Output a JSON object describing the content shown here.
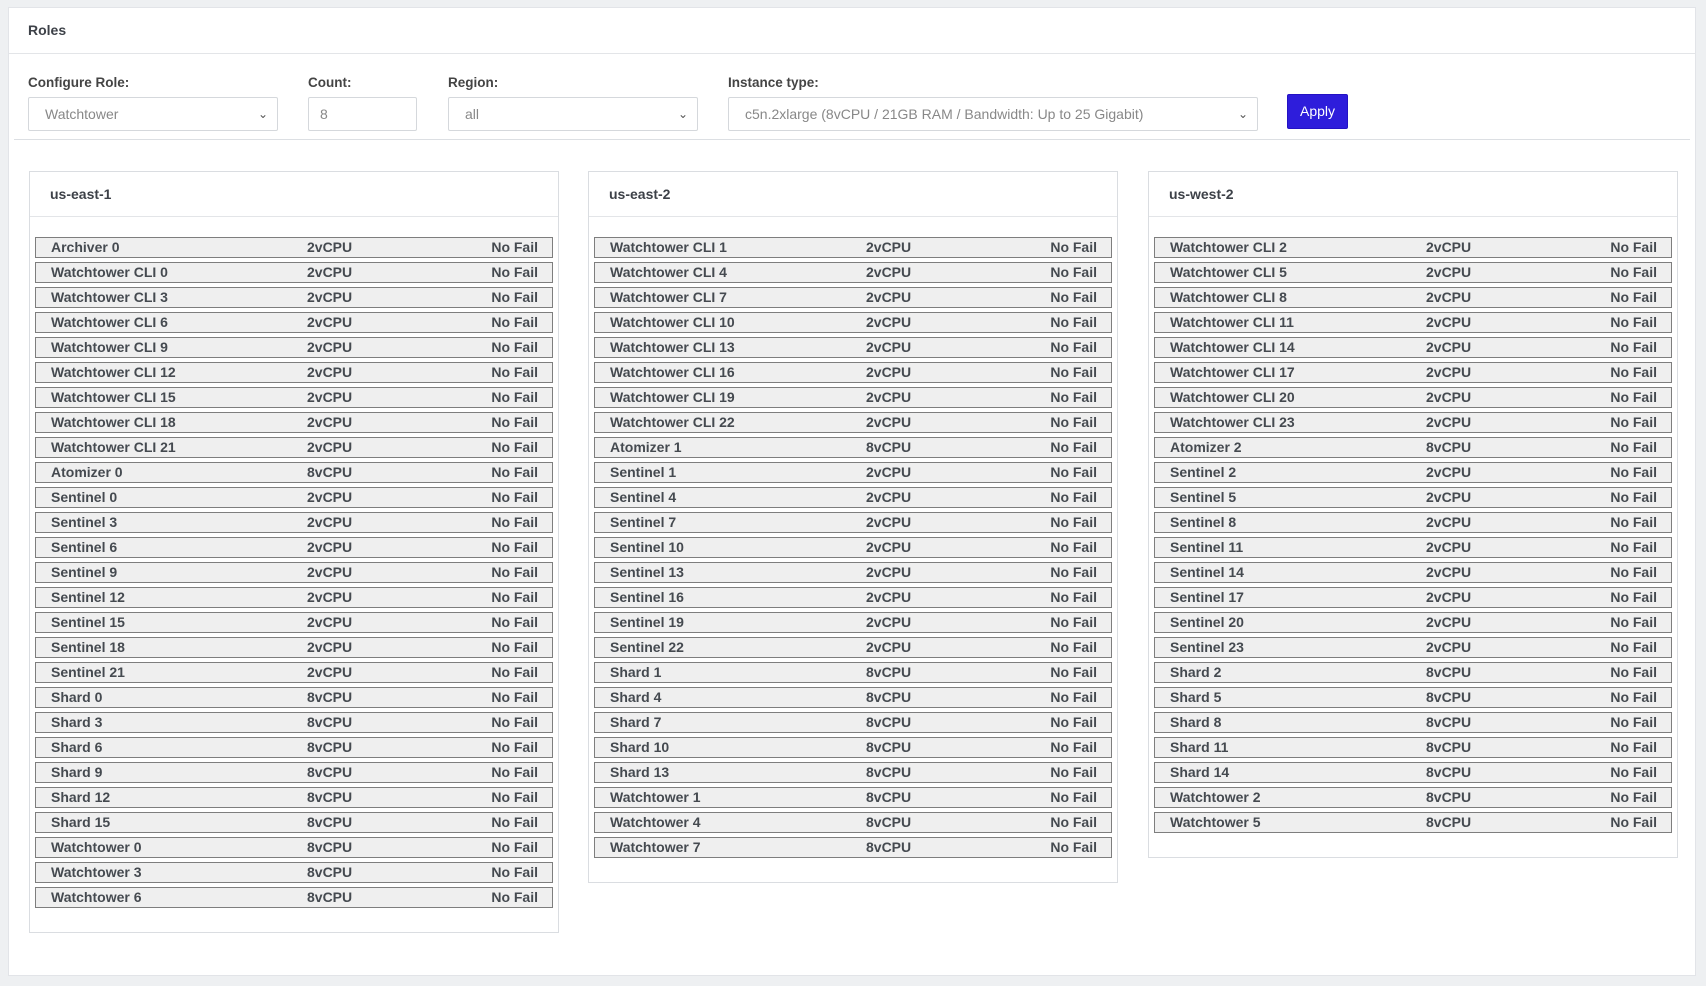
{
  "header": {
    "title": "Roles"
  },
  "form": {
    "role_label": "Configure Role:",
    "role_value": "Watchtower",
    "count_label": "Count:",
    "count_value": "8",
    "region_label": "Region:",
    "region_value": "all",
    "instance_label": "Instance type:",
    "instance_value": "c5n.2xlarge (8vCPU / 21GB RAM / Bandwidth: Up to 25 Gigabit)",
    "apply_label": "Apply"
  },
  "colors": {
    "accent": "#2e1ddb"
  },
  "regions": [
    {
      "name": "us-east-1",
      "nodes": [
        [
          "Archiver 0",
          "2vCPU",
          "No Fail"
        ],
        [
          "Watchtower CLI 0",
          "2vCPU",
          "No Fail"
        ],
        [
          "Watchtower CLI 3",
          "2vCPU",
          "No Fail"
        ],
        [
          "Watchtower CLI 6",
          "2vCPU",
          "No Fail"
        ],
        [
          "Watchtower CLI 9",
          "2vCPU",
          "No Fail"
        ],
        [
          "Watchtower CLI 12",
          "2vCPU",
          "No Fail"
        ],
        [
          "Watchtower CLI 15",
          "2vCPU",
          "No Fail"
        ],
        [
          "Watchtower CLI 18",
          "2vCPU",
          "No Fail"
        ],
        [
          "Watchtower CLI 21",
          "2vCPU",
          "No Fail"
        ],
        [
          "Atomizer 0",
          "8vCPU",
          "No Fail"
        ],
        [
          "Sentinel 0",
          "2vCPU",
          "No Fail"
        ],
        [
          "Sentinel 3",
          "2vCPU",
          "No Fail"
        ],
        [
          "Sentinel 6",
          "2vCPU",
          "No Fail"
        ],
        [
          "Sentinel 9",
          "2vCPU",
          "No Fail"
        ],
        [
          "Sentinel 12",
          "2vCPU",
          "No Fail"
        ],
        [
          "Sentinel 15",
          "2vCPU",
          "No Fail"
        ],
        [
          "Sentinel 18",
          "2vCPU",
          "No Fail"
        ],
        [
          "Sentinel 21",
          "2vCPU",
          "No Fail"
        ],
        [
          "Shard 0",
          "8vCPU",
          "No Fail"
        ],
        [
          "Shard 3",
          "8vCPU",
          "No Fail"
        ],
        [
          "Shard 6",
          "8vCPU",
          "No Fail"
        ],
        [
          "Shard 9",
          "8vCPU",
          "No Fail"
        ],
        [
          "Shard 12",
          "8vCPU",
          "No Fail"
        ],
        [
          "Shard 15",
          "8vCPU",
          "No Fail"
        ],
        [
          "Watchtower 0",
          "8vCPU",
          "No Fail"
        ],
        [
          "Watchtower 3",
          "8vCPU",
          "No Fail"
        ],
        [
          "Watchtower 6",
          "8vCPU",
          "No Fail"
        ]
      ]
    },
    {
      "name": "us-east-2",
      "nodes": [
        [
          "Watchtower CLI 1",
          "2vCPU",
          "No Fail"
        ],
        [
          "Watchtower CLI 4",
          "2vCPU",
          "No Fail"
        ],
        [
          "Watchtower CLI 7",
          "2vCPU",
          "No Fail"
        ],
        [
          "Watchtower CLI 10",
          "2vCPU",
          "No Fail"
        ],
        [
          "Watchtower CLI 13",
          "2vCPU",
          "No Fail"
        ],
        [
          "Watchtower CLI 16",
          "2vCPU",
          "No Fail"
        ],
        [
          "Watchtower CLI 19",
          "2vCPU",
          "No Fail"
        ],
        [
          "Watchtower CLI 22",
          "2vCPU",
          "No Fail"
        ],
        [
          "Atomizer 1",
          "8vCPU",
          "No Fail"
        ],
        [
          "Sentinel 1",
          "2vCPU",
          "No Fail"
        ],
        [
          "Sentinel 4",
          "2vCPU",
          "No Fail"
        ],
        [
          "Sentinel 7",
          "2vCPU",
          "No Fail"
        ],
        [
          "Sentinel 10",
          "2vCPU",
          "No Fail"
        ],
        [
          "Sentinel 13",
          "2vCPU",
          "No Fail"
        ],
        [
          "Sentinel 16",
          "2vCPU",
          "No Fail"
        ],
        [
          "Sentinel 19",
          "2vCPU",
          "No Fail"
        ],
        [
          "Sentinel 22",
          "2vCPU",
          "No Fail"
        ],
        [
          "Shard 1",
          "8vCPU",
          "No Fail"
        ],
        [
          "Shard 4",
          "8vCPU",
          "No Fail"
        ],
        [
          "Shard 7",
          "8vCPU",
          "No Fail"
        ],
        [
          "Shard 10",
          "8vCPU",
          "No Fail"
        ],
        [
          "Shard 13",
          "8vCPU",
          "No Fail"
        ],
        [
          "Watchtower 1",
          "8vCPU",
          "No Fail"
        ],
        [
          "Watchtower 4",
          "8vCPU",
          "No Fail"
        ],
        [
          "Watchtower 7",
          "8vCPU",
          "No Fail"
        ]
      ]
    },
    {
      "name": "us-west-2",
      "nodes": [
        [
          "Watchtower CLI 2",
          "2vCPU",
          "No Fail"
        ],
        [
          "Watchtower CLI 5",
          "2vCPU",
          "No Fail"
        ],
        [
          "Watchtower CLI 8",
          "2vCPU",
          "No Fail"
        ],
        [
          "Watchtower CLI 11",
          "2vCPU",
          "No Fail"
        ],
        [
          "Watchtower CLI 14",
          "2vCPU",
          "No Fail"
        ],
        [
          "Watchtower CLI 17",
          "2vCPU",
          "No Fail"
        ],
        [
          "Watchtower CLI 20",
          "2vCPU",
          "No Fail"
        ],
        [
          "Watchtower CLI 23",
          "2vCPU",
          "No Fail"
        ],
        [
          "Atomizer 2",
          "8vCPU",
          "No Fail"
        ],
        [
          "Sentinel 2",
          "2vCPU",
          "No Fail"
        ],
        [
          "Sentinel 5",
          "2vCPU",
          "No Fail"
        ],
        [
          "Sentinel 8",
          "2vCPU",
          "No Fail"
        ],
        [
          "Sentinel 11",
          "2vCPU",
          "No Fail"
        ],
        [
          "Sentinel 14",
          "2vCPU",
          "No Fail"
        ],
        [
          "Sentinel 17",
          "2vCPU",
          "No Fail"
        ],
        [
          "Sentinel 20",
          "2vCPU",
          "No Fail"
        ],
        [
          "Sentinel 23",
          "2vCPU",
          "No Fail"
        ],
        [
          "Shard 2",
          "8vCPU",
          "No Fail"
        ],
        [
          "Shard 5",
          "8vCPU",
          "No Fail"
        ],
        [
          "Shard 8",
          "8vCPU",
          "No Fail"
        ],
        [
          "Shard 11",
          "8vCPU",
          "No Fail"
        ],
        [
          "Shard 14",
          "8vCPU",
          "No Fail"
        ],
        [
          "Watchtower 2",
          "8vCPU",
          "No Fail"
        ],
        [
          "Watchtower 5",
          "8vCPU",
          "No Fail"
        ]
      ]
    }
  ]
}
